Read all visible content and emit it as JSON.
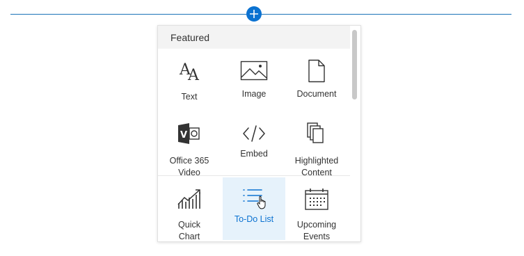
{
  "toolbox": {
    "header": "Featured",
    "tiles": [
      {
        "label": "Text",
        "icon": "text-icon"
      },
      {
        "label": "Image",
        "icon": "image-icon"
      },
      {
        "label": "Document",
        "icon": "document-icon"
      },
      {
        "label": "Office 365\nVideo",
        "icon": "office-365-video-icon"
      },
      {
        "label": "Embed",
        "icon": "embed-icon"
      },
      {
        "label": "Highlighted\nContent",
        "icon": "highlighted-content-icon"
      },
      {
        "label": "Quick\nChart",
        "icon": "quick-chart-icon"
      },
      {
        "label": "To-Do List",
        "icon": "todo-list-icon"
      },
      {
        "label": "Upcoming\nEvents",
        "icon": "calendar-icon"
      }
    ],
    "selected": "To-Do List"
  },
  "colors": {
    "accent": "#0b72d1",
    "selected_bg": "#e6f2fb",
    "header_bg": "#f3f3f3"
  },
  "add_button_icon": "plus-icon",
  "cursor_icon": "hand-pointer-icon"
}
